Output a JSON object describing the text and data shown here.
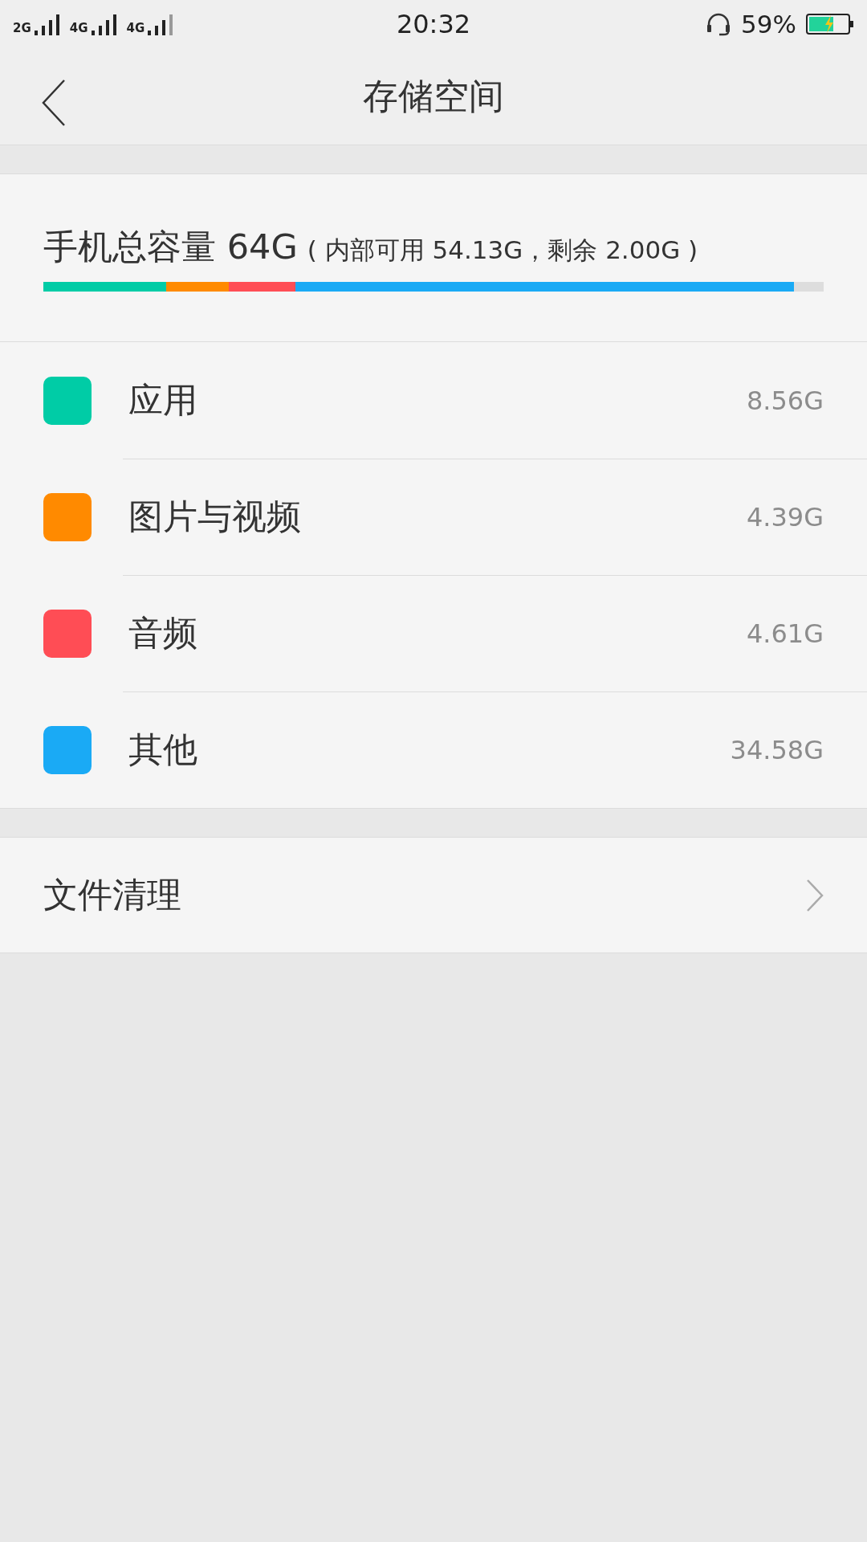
{
  "status_bar": {
    "network_labels": [
      "2G",
      "4G",
      "4G"
    ],
    "time": "20:32",
    "battery_percent": "59%"
  },
  "header": {
    "title": "存储空间"
  },
  "summary": {
    "title": "手机总容量 64G",
    "detail": "( 内部可用 54.13G，剩余 2.00G )"
  },
  "categories": [
    {
      "name": "应用",
      "size": "8.56G",
      "color": "#00cca6"
    },
    {
      "name": "图片与视频",
      "size": "4.39G",
      "color": "#ff8a00"
    },
    {
      "name": "音频",
      "size": "4.61G",
      "color": "#ff4d55"
    },
    {
      "name": "其他",
      "size": "34.58G",
      "color": "#1aaaf5"
    }
  ],
  "actions": [
    {
      "label": "文件清理"
    }
  ]
}
